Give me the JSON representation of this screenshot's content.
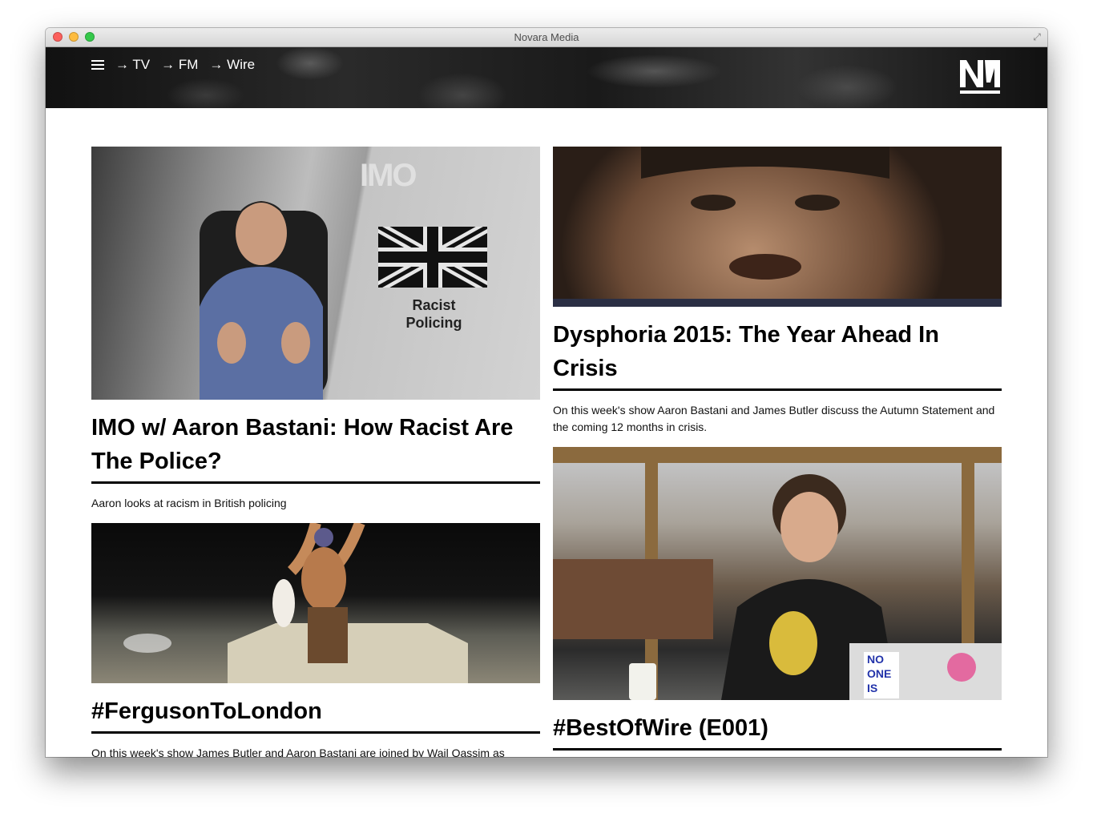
{
  "window": {
    "title": "Novara Media"
  },
  "nav": {
    "items": [
      {
        "label": "→ TV"
      },
      {
        "label": "→ FM"
      },
      {
        "label": "→ Wire"
      }
    ]
  },
  "articles": {
    "imo": {
      "title": "IMO w/ Aaron Bastani: How Racist Are The Police?",
      "description": "Aaron looks at racism in British policing",
      "image_text": {
        "brand": "IMO",
        "line1": "Racist",
        "line2": "Policing"
      }
    },
    "ferguson": {
      "title": "#FergusonToLondon",
      "description": "On this week's show James Butler and Aaron Bastani are joined by Wail Qassim as"
    },
    "dysphoria": {
      "title": "Dysphoria 2015: The Year Ahead In Crisis",
      "description": "On this week's show Aaron Bastani and James Butler discuss the Autumn Statement and the coming 12 months in crisis."
    },
    "wire": {
      "title": "#BestOfWire (E001)",
      "image_text": {
        "sign1": "NO",
        "sign2": "ONE",
        "sign3": "IS"
      }
    }
  },
  "colors": {
    "header_bg": "#1a1a1a",
    "text": "#000000",
    "accent": "#ffffff"
  }
}
